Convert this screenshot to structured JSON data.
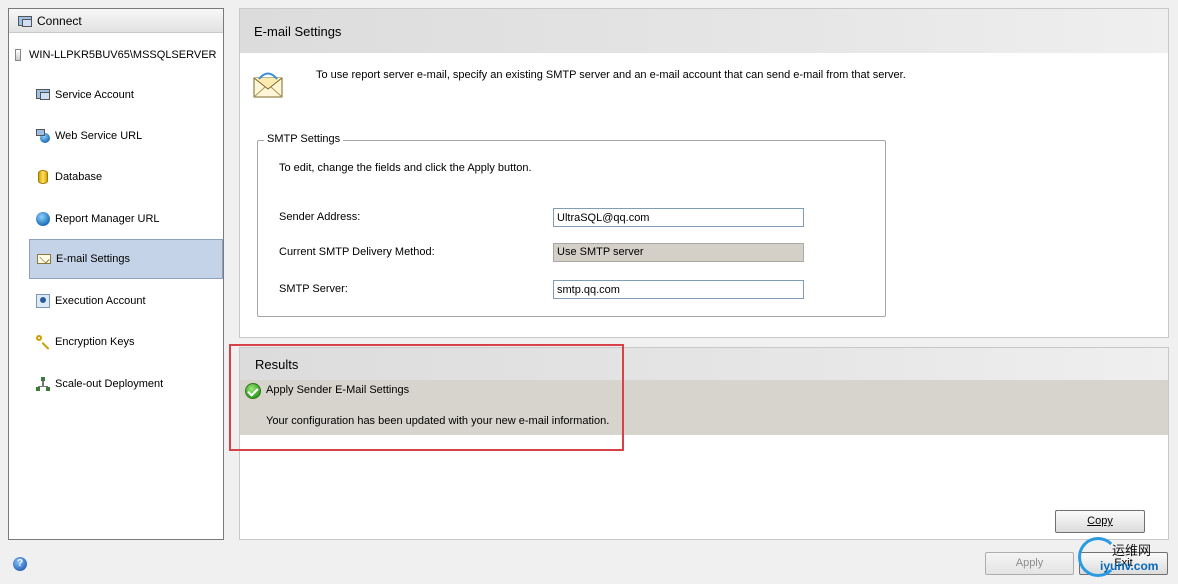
{
  "nav": {
    "connect_label": "Connect",
    "server_name": "WIN-LLPKR5BUV65\\MSSQLSERVER",
    "items": [
      {
        "label": "Service Account",
        "icon": "service-account-icon"
      },
      {
        "label": "Web Service URL",
        "icon": "web-service-icon"
      },
      {
        "label": "Database",
        "icon": "database-icon"
      },
      {
        "label": "Report Manager URL",
        "icon": "globe-icon"
      },
      {
        "label": "E-mail Settings",
        "icon": "email-icon",
        "selected": true
      },
      {
        "label": "Execution Account",
        "icon": "user-icon"
      },
      {
        "label": "Encryption Keys",
        "icon": "key-icon"
      },
      {
        "label": "Scale-out Deployment",
        "icon": "network-icon"
      }
    ]
  },
  "email": {
    "title": "E-mail Settings",
    "intro": "To use report server e-mail, specify an existing SMTP server and an e-mail account that can send e-mail from that server.",
    "group_title": "SMTP Settings",
    "help": "To edit, change the fields and click the Apply button.",
    "sender_label": "Sender Address:",
    "sender_value": "UltraSQL@qq.com",
    "method_label": "Current SMTP Delivery Method:",
    "method_value": "Use SMTP server",
    "server_label": "SMTP Server:",
    "server_value": "smtp.qq.com"
  },
  "results": {
    "title": "Results",
    "item_title": "Apply Sender E-Mail Settings",
    "item_message": "Your configuration has been updated with your new e-mail information."
  },
  "buttons": {
    "copy": "Copy",
    "apply": "Apply",
    "exit": "Exit"
  },
  "watermark": {
    "cn": "运维网",
    "url": "iyunv.com"
  },
  "colors": {
    "selected_bg": "#c5d3e8",
    "highlight_border": "#d9414a",
    "result_bg": "#d6d4cc"
  }
}
